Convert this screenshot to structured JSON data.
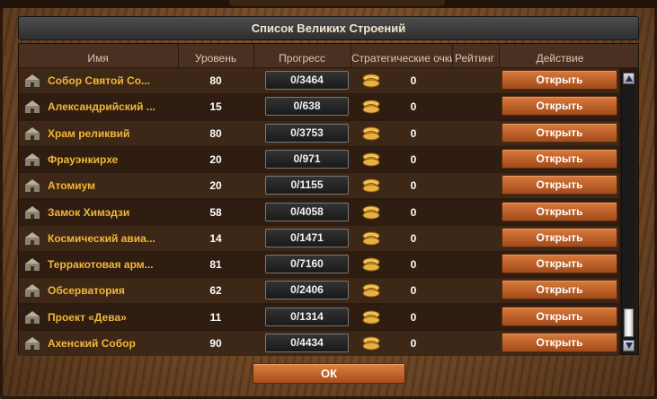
{
  "window": {
    "title": "Список Великих Строений"
  },
  "table": {
    "columns": {
      "name": "Имя",
      "level": "Уровень",
      "progress": "Прогресс",
      "strategy_points": "Стратегические очки",
      "rating": "Рейтинг",
      "action": "Действие"
    },
    "rows": [
      {
        "name": "Собор Святой Со...",
        "level": "80",
        "progress": "0/3464",
        "sp": "0",
        "action": "Открыть",
        "icon": "cathedral-icon"
      },
      {
        "name": "Александрийский ...",
        "level": "15",
        "progress": "0/638",
        "sp": "0",
        "action": "Открыть",
        "icon": "lighthouse-icon"
      },
      {
        "name": "Храм реликвий",
        "level": "80",
        "progress": "0/3753",
        "sp": "0",
        "action": "Открыть",
        "icon": "temple-icon"
      },
      {
        "name": "Фрауэнкирхе",
        "level": "20",
        "progress": "0/971",
        "sp": "0",
        "action": "Открыть",
        "icon": "church-icon"
      },
      {
        "name": "Атомиум",
        "level": "20",
        "progress": "0/1155",
        "sp": "0",
        "action": "Открыть",
        "icon": "atomium-icon"
      },
      {
        "name": "Замок Химэдзи",
        "level": "58",
        "progress": "0/4058",
        "sp": "0",
        "action": "Открыть",
        "icon": "castle-icon"
      },
      {
        "name": "Космический авиа...",
        "level": "14",
        "progress": "0/1471",
        "sp": "0",
        "action": "Открыть",
        "icon": "spaceplane-icon"
      },
      {
        "name": "Терракотовая арм...",
        "level": "81",
        "progress": "0/7160",
        "sp": "0",
        "action": "Открыть",
        "icon": "terracotta-army-icon"
      },
      {
        "name": "Обсерватория",
        "level": "62",
        "progress": "0/2406",
        "sp": "0",
        "action": "Открыть",
        "icon": "observatory-icon"
      },
      {
        "name": "Проект «Дева»",
        "level": "11",
        "progress": "0/1314",
        "sp": "0",
        "action": "Открыть",
        "icon": "eye-icon"
      },
      {
        "name": "Ахенский Собор",
        "level": "90",
        "progress": "0/4434",
        "sp": "0",
        "action": "Открыть",
        "icon": "aachen-cathedral-icon"
      }
    ]
  },
  "footer": {
    "ok_label": "ОК"
  },
  "icons": {
    "strategy_points": "strategy-points-scroll-icon"
  },
  "colors": {
    "name_text": "#f2b63a",
    "button": "#c8642a",
    "panel": "#2a1a0f",
    "wood": "#7a4c26"
  }
}
